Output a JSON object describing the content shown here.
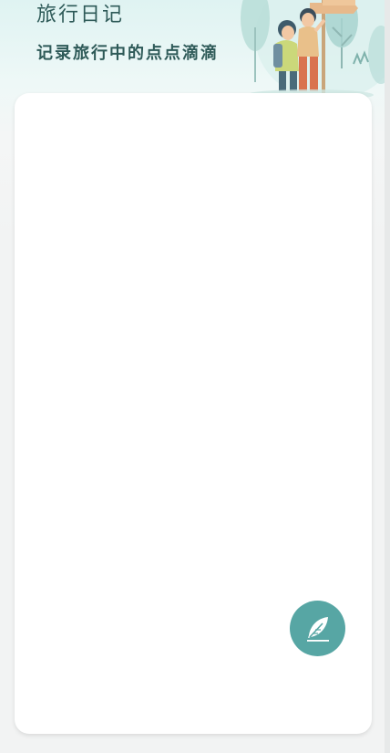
{
  "header": {
    "title": "旅行日记",
    "subtitle": "记录旅行中的点点滴滴",
    "illustration": "travelers-with-signpost-illustration"
  },
  "diary_list": {
    "entries": []
  },
  "fab": {
    "icon": "feather-pen-icon"
  },
  "colors": {
    "header_gradient_top": "#dff3f2",
    "title_text": "#2e5a58",
    "card_background": "#ffffff",
    "page_background": "#f2f3f3",
    "accent": "#57a6a4"
  }
}
